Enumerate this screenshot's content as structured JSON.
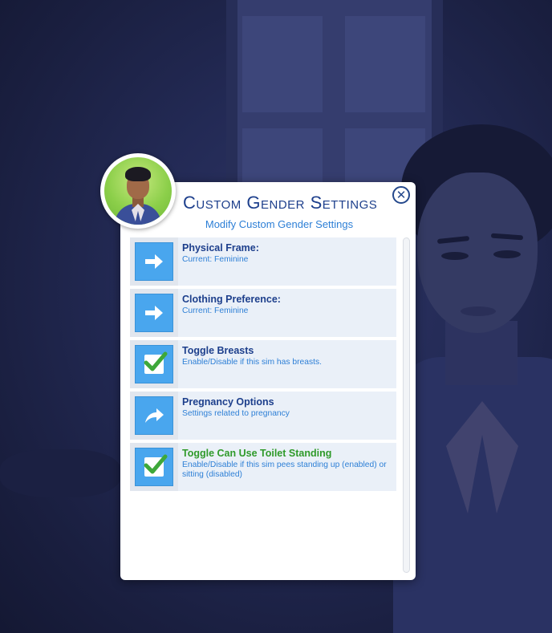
{
  "dialog": {
    "title": "Custom Gender Settings",
    "subtitle": "Modify Custom Gender Settings",
    "close_icon": "close-icon"
  },
  "colors": {
    "title": "#1d3f8c",
    "subtitle": "#2d7fd6",
    "icon_bg": "#49a6ee",
    "highlight_label": "#2f9a2a",
    "item_bg": "#eaf0f8"
  },
  "items": [
    {
      "icon": "arrow-right-icon",
      "label": "Physical Frame:",
      "desc": "Current: Feminine"
    },
    {
      "icon": "arrow-right-icon",
      "label": "Clothing Preference:",
      "desc": "Current: Feminine"
    },
    {
      "icon": "checkbox-checked-icon",
      "label": "Toggle Breasts",
      "desc": "Enable/Disable if this sim has breasts."
    },
    {
      "icon": "curved-arrow-icon",
      "label": "Pregnancy Options",
      "desc": "Settings related to pregnancy"
    },
    {
      "icon": "checkbox-checked-icon",
      "label": "Toggle Can Use Toilet Standing",
      "desc": "Enable/Disable if this sim pees standing up (enabled) or sitting (disabled)"
    }
  ]
}
